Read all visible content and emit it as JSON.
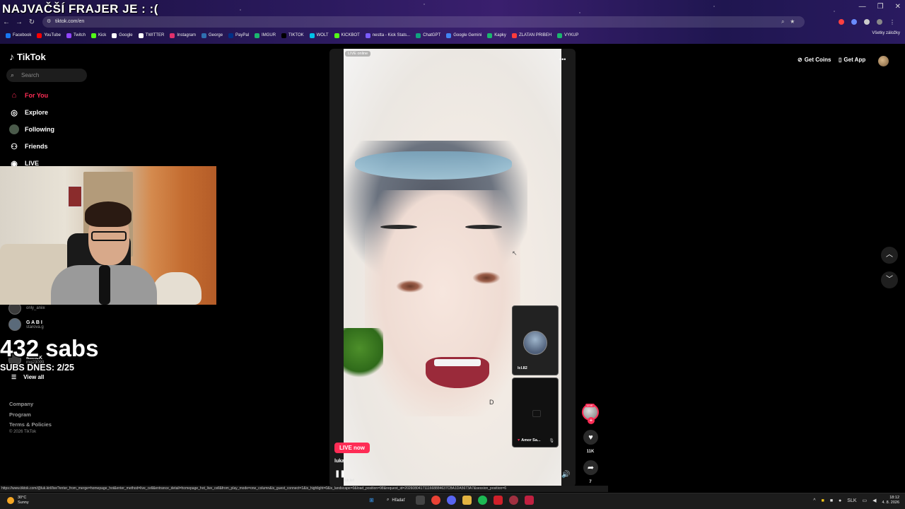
{
  "overlay": {
    "title": "NAJVAČŠÍ FRAJER JE :  :(",
    "subs_count": "432 sabs",
    "subs_today": "SUBS DNES: 2/25"
  },
  "browser": {
    "url": "tiktok.com/en",
    "bookmarks": [
      "Facebook",
      "YouTube",
      "Twitch",
      "Kick",
      "Google",
      "TWITTER",
      "Instagram",
      "George",
      "PayPal",
      "IMGUR",
      "TIKTOK",
      "WOLT",
      "KICKBOT",
      "nestta - Kick Stats...",
      "ChatGPT",
      "Google Gemini",
      "Kapky",
      "ZLATAN PRIBEH",
      "VYKUP"
    ],
    "bookmark_colors": [
      "#1877f2",
      "#ff0000",
      "#9146ff",
      "#53fc18",
      "#ffffff",
      "#ffffff",
      "#e1306c",
      "#2f6fb0",
      "#003087",
      "#1bb76e",
      "#000000",
      "#00c2e8",
      "#53fc18",
      "#7a5cff",
      "#10a37f",
      "#4285f4",
      "#1bb76e",
      "#ff3b3b",
      "#1bb76e"
    ],
    "all_bookmarks": "Všetky záložky",
    "status_url": "https://www.tiktok.com/@luk.kirl/live?enter_from_merge=homepage_hot&enter_method=live_cell&entrance_detail=homepage_hot_live_cell&from_play_mode=one_column&is_guest_connect=1&is_highlight=0&is_landscape=0&load_position=98&request_id=2026080417111668884637CBA1DA5673A7&session_position=6"
  },
  "tiktok": {
    "logo": "TikTok",
    "search_placeholder": "Search",
    "nav": [
      "For You",
      "Explore",
      "Following",
      "Friends",
      "LIVE"
    ],
    "accounts": [
      {
        "name": "",
        "sub": "only_aniix"
      },
      {
        "name": "G A B I",
        "sub": "starova.g"
      },
      {
        "name": "MimcK",
        "sub": "rng23099"
      }
    ],
    "view_all": "View all",
    "footer": [
      "Company",
      "Program",
      "Terms & Policies"
    ],
    "copyright": "© 2026 TikTok",
    "header": {
      "get_coins": "Get Coins",
      "get_app": "Get App"
    }
  },
  "player": {
    "live_online": "LIVE online",
    "live_now": "LIVE now",
    "creator_short": "luka",
    "creator_tag": "luk.kirl",
    "letter": "D",
    "guests": [
      {
        "name": "lcl.82"
      },
      {
        "name": "Amor Sa..."
      }
    ],
    "likes": "11K",
    "shares": "7"
  },
  "taskbar": {
    "temp": "30°C",
    "weather": "Sunny",
    "search": "Hľadať",
    "lang": "SLK",
    "time": "18:12",
    "date": "4. 8. 2026"
  },
  "colors": {
    "accent": "#fe2c55",
    "background": "#000000"
  }
}
